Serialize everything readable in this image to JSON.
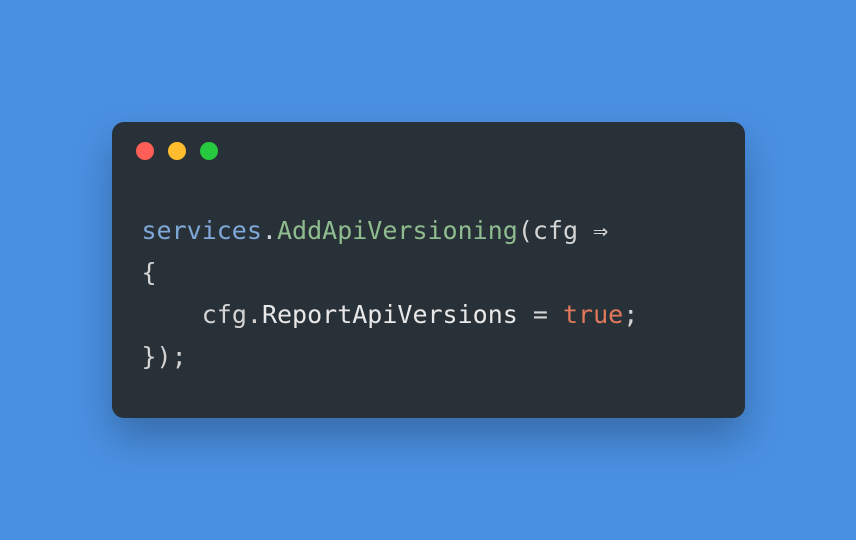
{
  "window": {
    "controls": {
      "close_color": "#ff5f56",
      "minimize_color": "#ffbd2e",
      "zoom_color": "#27c93f"
    }
  },
  "code": {
    "line1": {
      "var": "services",
      "dot": ".",
      "method": "AddApiVersioning",
      "open": "(",
      "param": "cfg ",
      "arrow": "⇒"
    },
    "line2": {
      "brace": "{"
    },
    "line3": {
      "indent": "    ",
      "param": "cfg",
      "dot": ".",
      "prop": "ReportApiVersions",
      "assign": " = ",
      "keyword": "true",
      "semi": ";"
    },
    "line4": {
      "close": "});"
    }
  }
}
